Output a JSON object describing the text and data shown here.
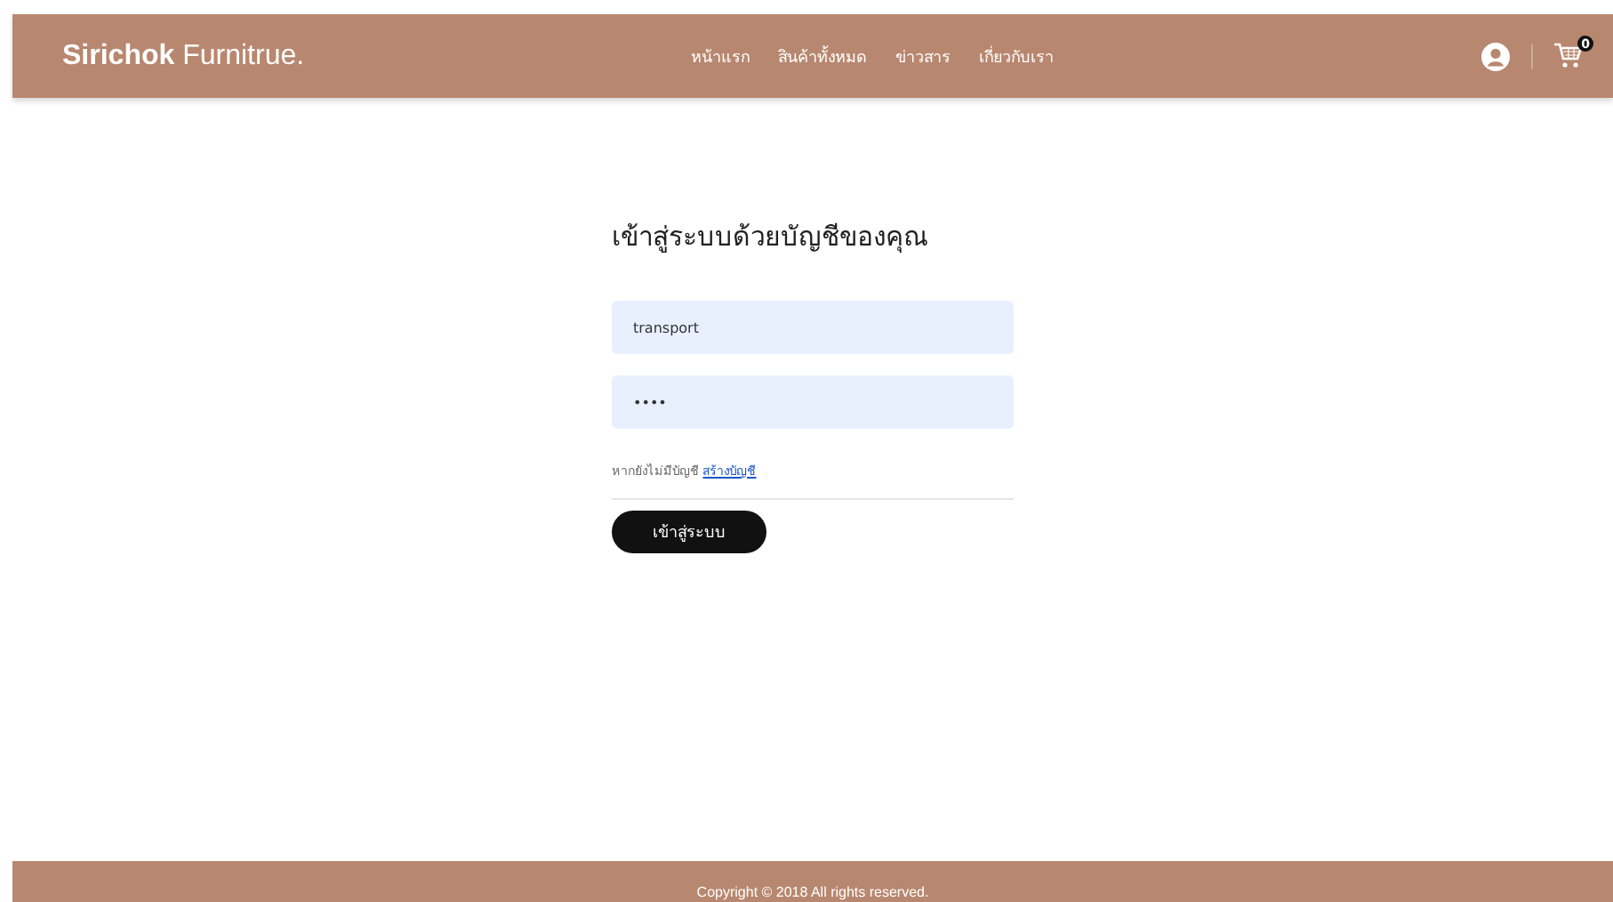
{
  "header": {
    "brand_bold": "Sirichok",
    "brand_rest": "Furnitrue.",
    "nav": [
      {
        "label": "หน้าแรก"
      },
      {
        "label": "สินค้าทั้งหมด"
      },
      {
        "label": "ข่าวสาร"
      },
      {
        "label": "เกี่ยวกับเรา"
      }
    ],
    "cart_count": "0"
  },
  "login": {
    "title": "เข้าสู่ระบบด้วยบัญชีของคุณ",
    "username": {
      "value": "transport"
    },
    "password": {
      "value": "••••"
    },
    "register_prompt": "หากยังไม่มีบัญชี",
    "register_link": "สร้างบัญชี",
    "submit": "เข้าสู่ระบบ"
  },
  "footer": {
    "copyright": "Copyright © 2018 All rights reserved."
  }
}
